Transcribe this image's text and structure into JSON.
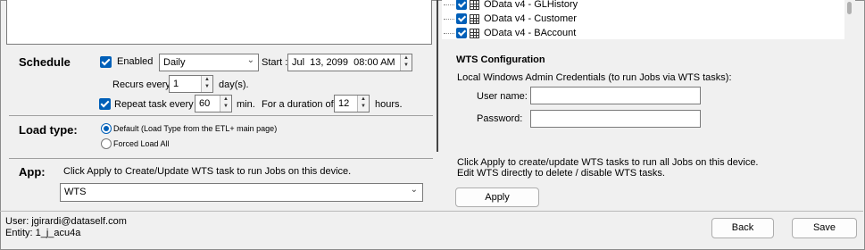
{
  "tree": {
    "items": [
      {
        "label": "OData v4 - GLHistory"
      },
      {
        "label": "OData v4 - Customer"
      },
      {
        "label": "OData v4 - BAccount"
      }
    ]
  },
  "schedule": {
    "heading": "Schedule",
    "enabled_label": "Enabled",
    "frequency": "Daily",
    "start_label": "Start :",
    "start_value": "Jul  13, 2099  08:00 AM",
    "recurs_label": "Recurs every:",
    "recurs_value": "1",
    "recurs_unit": "day(s).",
    "repeat_label": "Repeat task every",
    "repeat_value": "60",
    "repeat_unit": "min.",
    "duration_label": "For a duration of",
    "duration_value": "12",
    "duration_unit": "hours."
  },
  "load_type": {
    "heading": "Load type:",
    "option_default": "Default (Load Type from the  ETL+ main page)",
    "option_forced": "Forced Load All"
  },
  "app": {
    "heading": "App:",
    "description": "Click Apply to Create/Update WTS task to run Jobs on this device.",
    "selected": "WTS"
  },
  "wts": {
    "heading": "WTS Configuration",
    "credentials_text": "Local Windows Admin Credentials (to run Jobs via WTS tasks):",
    "username_label": "User name:",
    "username_value": "",
    "password_label": "Password:",
    "password_value": "",
    "info_line1": "Click Apply to create/update WTS tasks to run all Jobs on this device.",
    "info_line2": "Edit WTS directly to delete / disable WTS tasks.",
    "apply_label": "Apply"
  },
  "footer": {
    "user_line": "User:  jgirardi@dataself.com",
    "entity_line": "Entity: 1_j_acu4a",
    "back_label": "Back",
    "save_label": "Save"
  }
}
